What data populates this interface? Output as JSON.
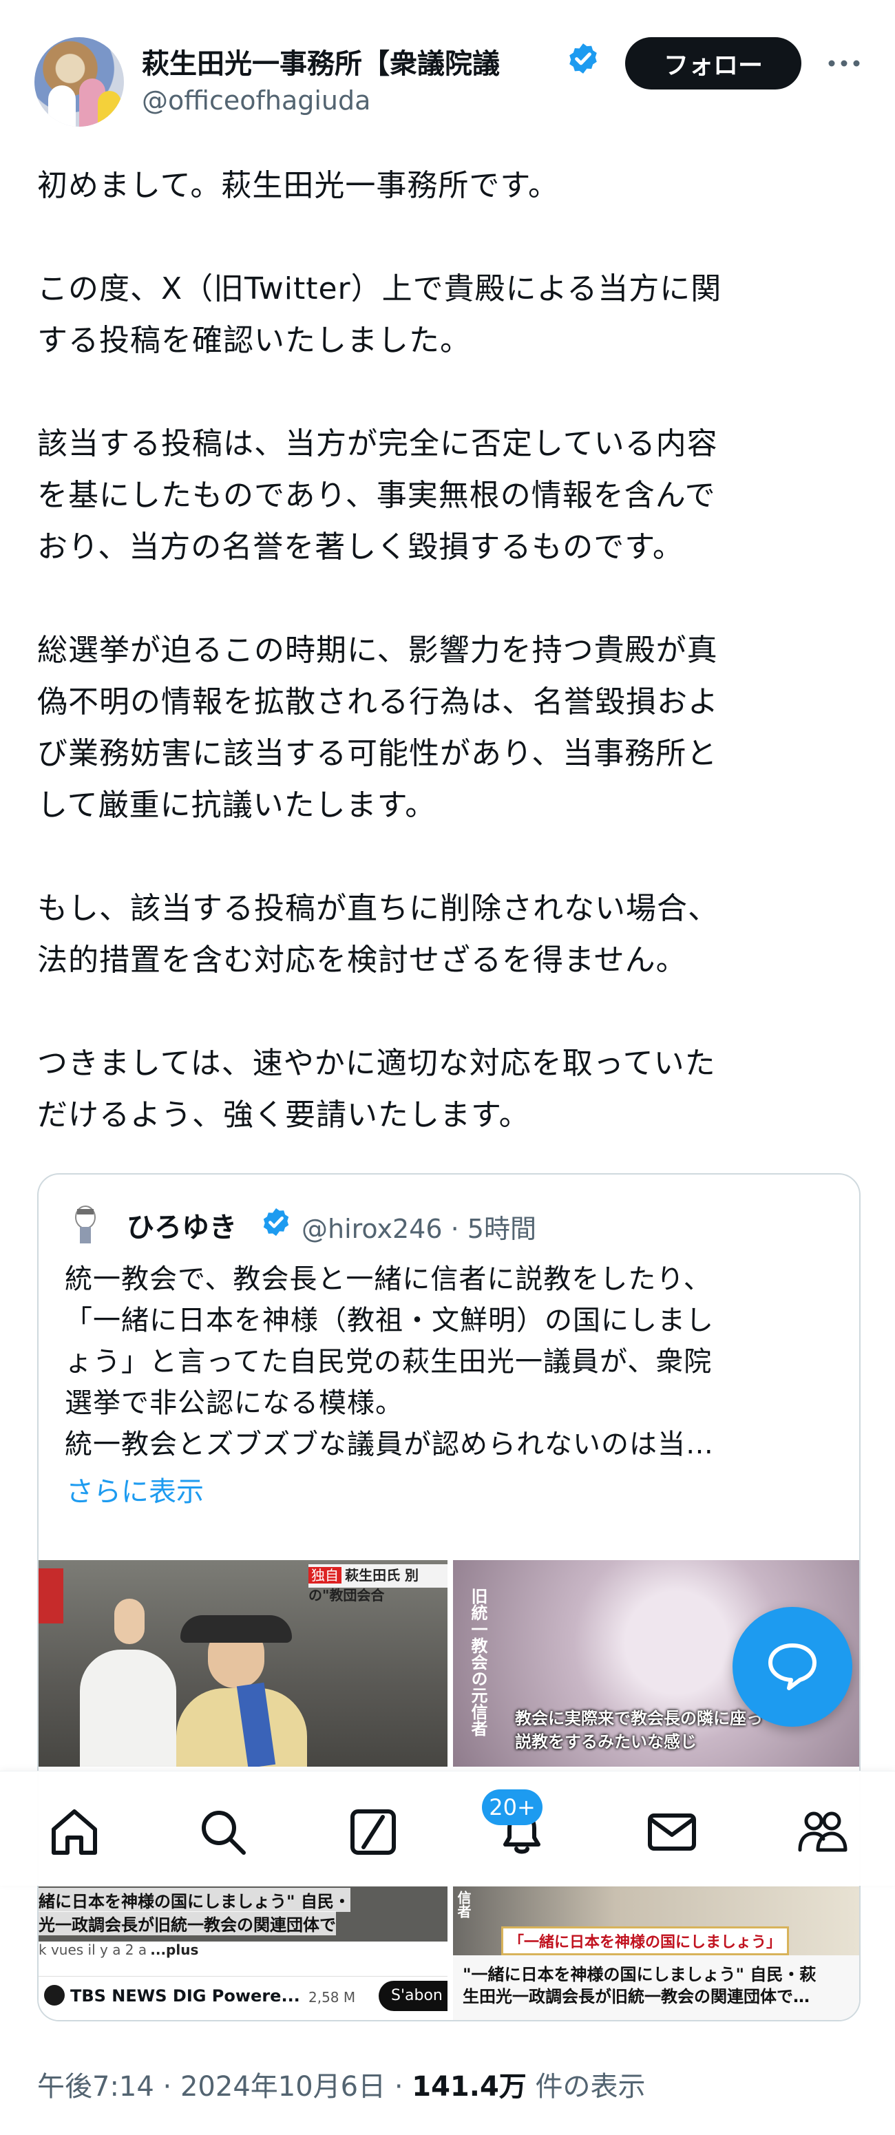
{
  "author": {
    "display_name": "萩生田光一事務所【衆議院議",
    "handle": "@officeofhagiuda"
  },
  "follow_label": "フォロー",
  "paragraphs": [
    "初めまして。萩生田光一事務所です。",
    "この度、X（旧Twitter）上で貴殿による当方に関\nする投稿を確認いたしました。",
    "該当する投稿は、当方が完全に否定している内容\nを基にしたものであり、事実無根の情報を含んで\nおり、当方の名誉を著しく毀損するものです。",
    "総選挙が迫るこの時期に、影響力を持つ貴殿が真\n偽不明の情報を拡散される行為は、名誉毀損およ\nび業務妨害に該当する可能性があり、当事務所と\nして厳重に抗議いたします。",
    "もし、該当する投稿が直ちに削除されない場合、\n法的措置を含む対応を検討せざるを得ません。",
    "つきましては、速やかに適切な対応を取っていた\nだけるよう、強く要請いたします。"
  ],
  "quote": {
    "name": "ひろゆき",
    "handle_time": "@hirox246 · 5時間",
    "text": "統一教会で、教会長と一緒に信者に説教をしたり、\n「一緒に日本を神様（教祖・文鮮明）の国にしまし\nょう」と言ってた自民党の萩生田光一議員が、衆院\n選挙で非公認になる模様。\n統一教会とズブズブな議員が認められないのは当…",
    "show_more": "さらに表示",
    "media_left": {
      "banner": "萩生田氏 別の\"教団会合",
      "banner_tag": "独自"
    },
    "media_right": {
      "side_caption": "旧統一教会の元信者",
      "caption_line1": "教会に実際来で教会長の隣に座っ",
      "caption_line2": "説教をするみたいな感じ"
    },
    "lower_left": {
      "overlay_line1": "緒に日本を神様の国にしましょう\" 自民・",
      "overlay_line2": "光一政調会長が旧統一教会の関連団体で",
      "views": "k vues  il y a 2 a",
      "plus": "...plus",
      "channel": "TBS NEWS DIG Powere...",
      "subs": "2,58 M",
      "subscribe": "S'abon"
    },
    "lower_right": {
      "side_caption": "信者",
      "banner": "「一緒に日本を神様の国にしましょう」",
      "title": "\"一緒に日本を神様の国にしましょう\" 自民・萩\n生田光一政調会長が旧統一教会の関連団体で…"
    }
  },
  "meta": {
    "time": "午後7:14 · 2024年10月6日 · ",
    "views_count": "141.4万",
    "views_label": " 件の表示"
  },
  "nav": {
    "notifications_badge": "20+",
    "items": [
      "home-icon",
      "search-icon",
      "grok-icon",
      "notifications-icon",
      "messages-icon",
      "communities-icon"
    ]
  },
  "colors": {
    "accent": "#1d9bf0",
    "text": "#0f1419",
    "secondary": "#536471",
    "border": "#cfd9de"
  }
}
